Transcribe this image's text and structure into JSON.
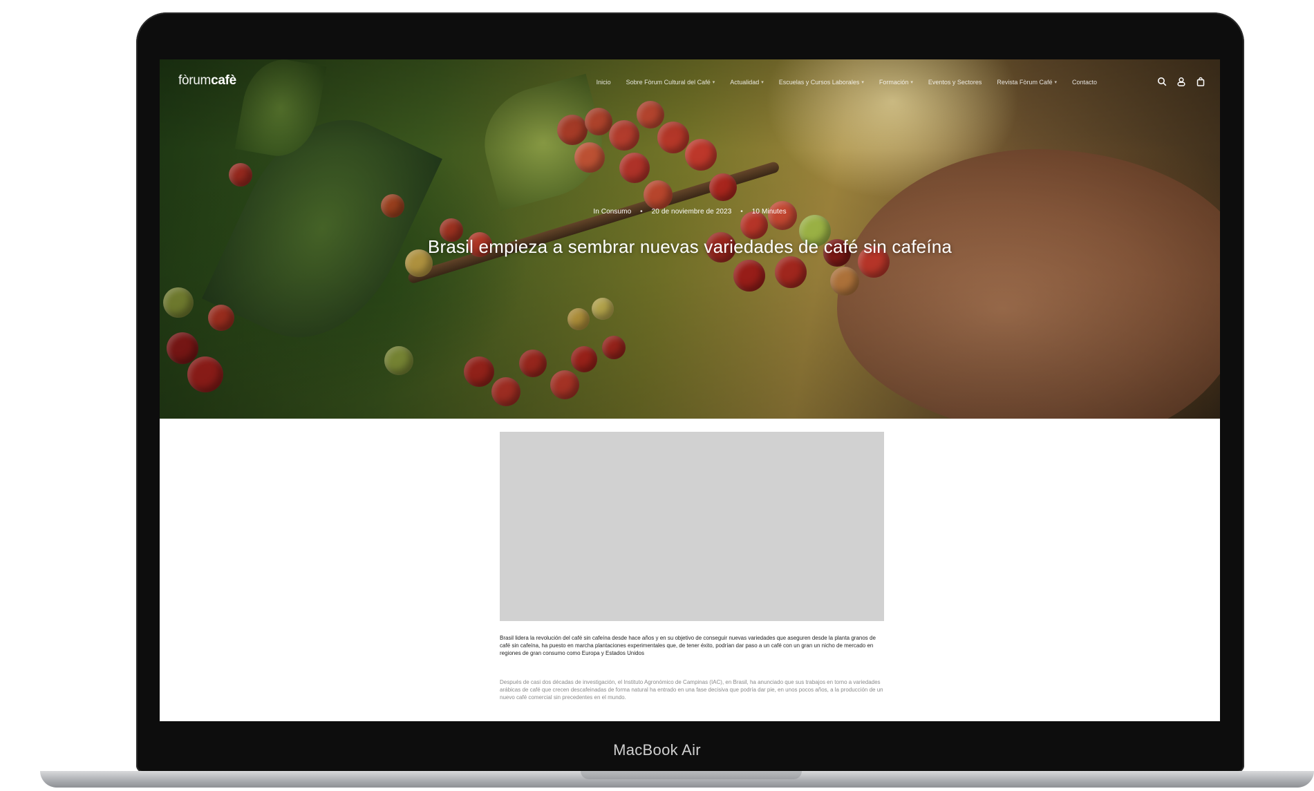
{
  "device": {
    "label": "MacBook Air"
  },
  "site": {
    "logo_light": "fòrum",
    "logo_bold": "cafè",
    "nav": [
      {
        "label": "Inicio",
        "has_dropdown": false
      },
      {
        "label": "Sobre Fòrum Cultural del Café",
        "has_dropdown": true
      },
      {
        "label": "Actualidad",
        "has_dropdown": true
      },
      {
        "label": "Escuelas y Cursos Laborales",
        "has_dropdown": true
      },
      {
        "label": "Formación",
        "has_dropdown": true
      },
      {
        "label": "Eventos y Sectores",
        "has_dropdown": false
      },
      {
        "label": "Revista Fòrum Café",
        "has_dropdown": true
      },
      {
        "label": "Contacto",
        "has_dropdown": false
      }
    ],
    "icons": [
      "search-icon",
      "user-icon",
      "cart-icon"
    ]
  },
  "article": {
    "category": "In Consumo",
    "date": "20 de noviembre de 2023",
    "read_time": "10 Minutes",
    "title": "Brasil empieza a sembrar nuevas variedades de café sin cafeína",
    "lead": "Brasil lidera la revolución del café sin cafeína desde hace años y en su objetivo de conseguir nuevas variedades que aseguren desde la planta granos de café sin cafeína, ha puesto en marcha plantaciones experimentales que, de tener éxito, podrían dar paso a un café con un gran un nicho de mercado en regiones de gran consumo como Europa y Estados Unidos",
    "body": "Después de casi dos décadas de investigación, el Instituto Agronómico de Campinas (IAC), en Brasil, ha anunciado que sus trabajos en torno a variedades arábicas de café que crecen descafeinadas de forma natural ha entrado en una fase decisiva que podría dar pie, en unos pocos años, a la producción de un nuevo café comercial sin precedentes en el mundo."
  },
  "colors": {
    "bezel": "#0d0d0d",
    "placeholder": "#d1d1d1",
    "lead_text": "#1d1d1d",
    "body_text": "#8a8a8a"
  }
}
